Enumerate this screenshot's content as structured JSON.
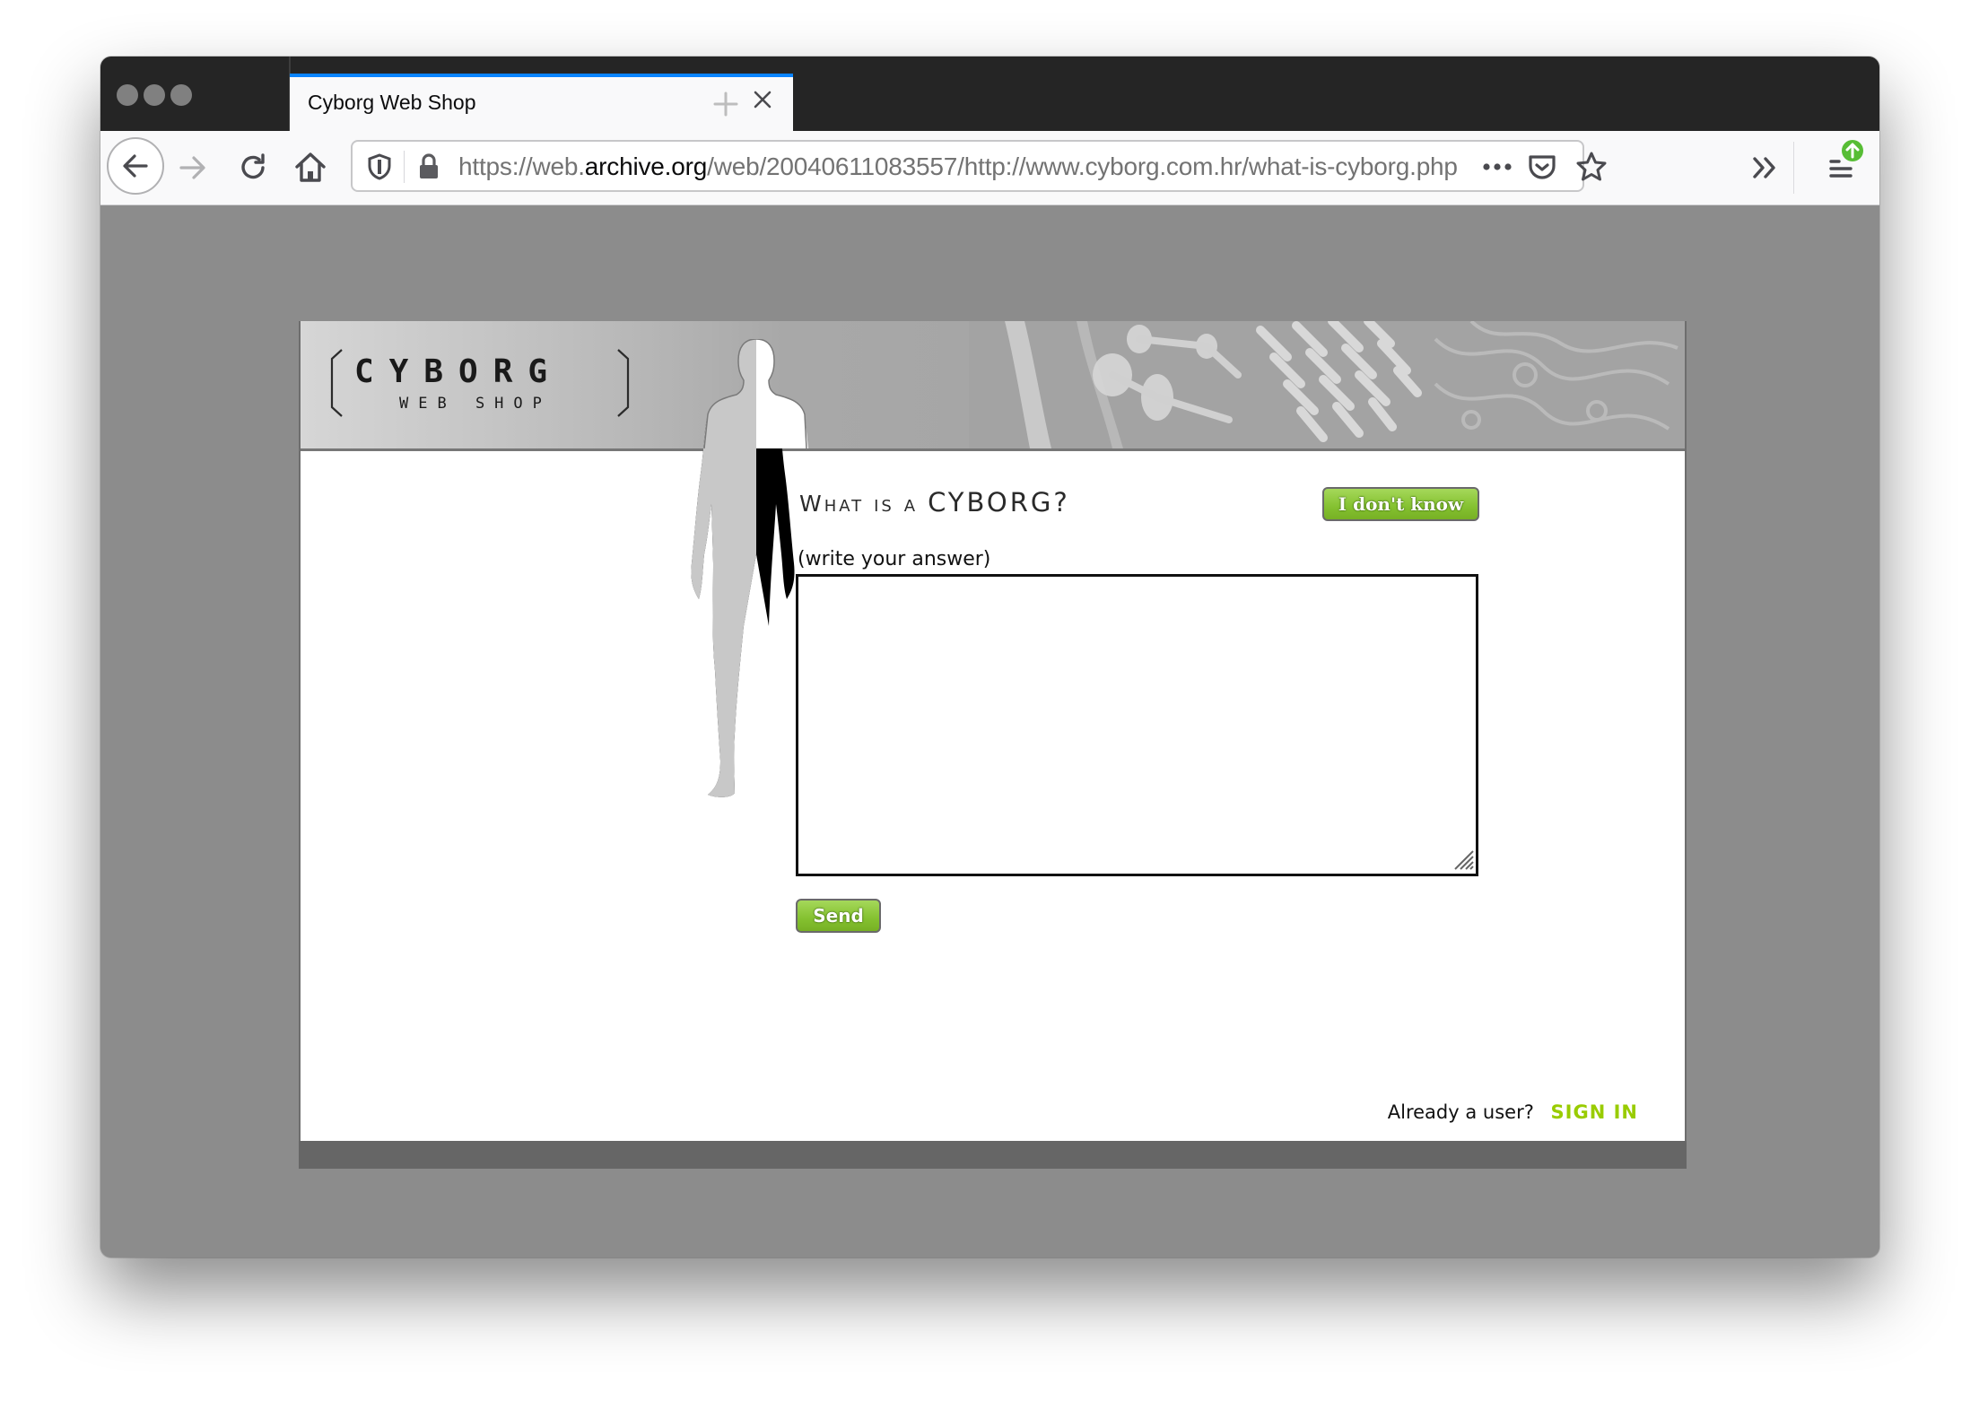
{
  "browser": {
    "tab": {
      "title": "Cyborg Web Shop",
      "close_icon": "close-icon",
      "active_indicator_color": "#0a84ff"
    },
    "new_tab_icon": "plus-icon",
    "nav": {
      "back_icon": "arrow-left-icon",
      "forward_icon": "arrow-right-icon",
      "reload_icon": "reload-icon",
      "home_icon": "home-icon"
    },
    "url_bar": {
      "shield_icon": "tracking-protection-shield-icon",
      "lock_icon": "lock-icon",
      "url_prefix": "https://web.",
      "url_host": "archive.org",
      "url_path": "/web/20040611083557/http://www.cyborg.com.hr/what-is-cyborg.php",
      "page_actions_icon": "more-horizontal-icon",
      "pocket_icon": "pocket-icon",
      "bookmark_icon": "star-icon"
    },
    "overflow_icon": "chevron-double-right-icon",
    "menu_icon": "hamburger-menu-icon",
    "update_badge_icon": "arrow-up-badge-icon",
    "update_badge_color": "#57bd35"
  },
  "page": {
    "logo": {
      "title": "CYBORG",
      "subtitle": "WEB SHOP"
    },
    "question": {
      "prefix": "What is a ",
      "highlight": "CYBORG?"
    },
    "dont_know_button": "I don't know",
    "answer_label": "(write your answer)",
    "answer_value": "",
    "send_button": "Send",
    "signin": {
      "prompt": "Already a user?",
      "link": "SIGN IN",
      "link_color": "#99cc00"
    },
    "accent_green": "#84c130"
  }
}
